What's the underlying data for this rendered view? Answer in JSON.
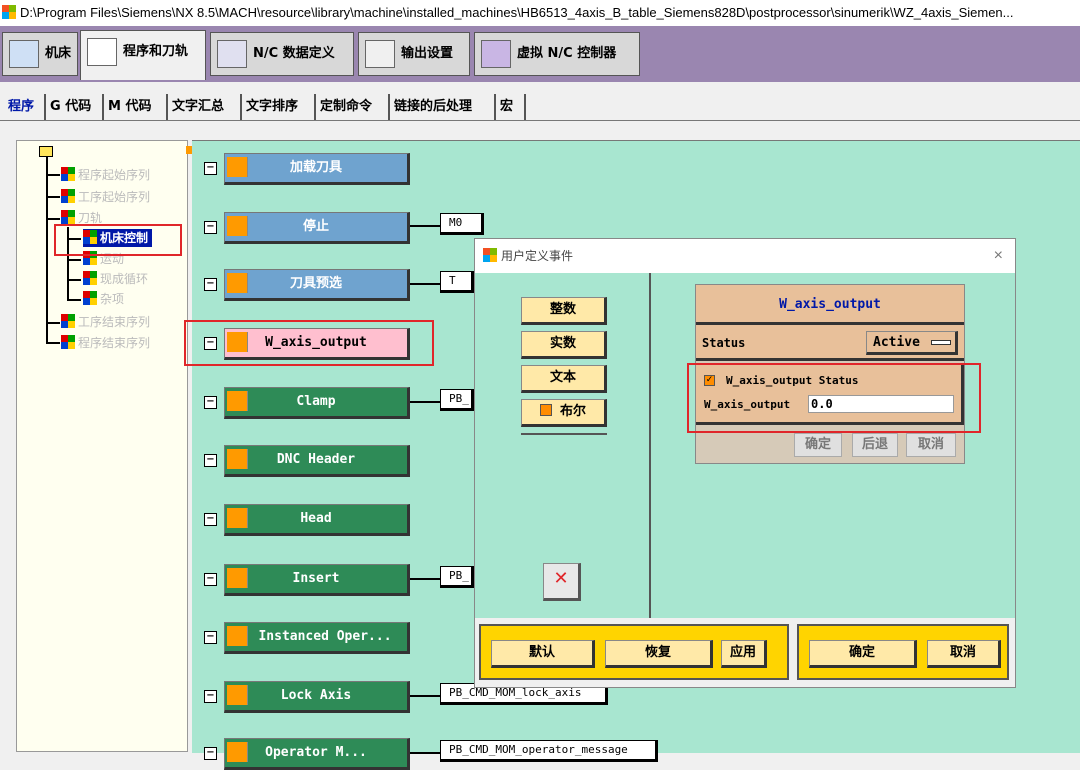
{
  "window": {
    "title": "D:\\Program Files\\Siemens\\NX 8.5\\MACH\\resource\\library\\machine\\installed_machines\\HB6513_4axis_B_table_Siemens828D\\postprocessor\\sinumerik\\WZ_4axis_Siemen..."
  },
  "main_tabs": [
    {
      "label": "机床"
    },
    {
      "label": "程序和刀轨"
    },
    {
      "label": "N/C 数据定义"
    },
    {
      "label": "输出设置"
    },
    {
      "label": "虚拟 N/C 控制器"
    }
  ],
  "sub_tabs": [
    {
      "label": "程序"
    },
    {
      "label": "G 代码"
    },
    {
      "label": "M 代码"
    },
    {
      "label": "文字汇总"
    },
    {
      "label": "文字排序"
    },
    {
      "label": "定制命令"
    },
    {
      "label": "链接的后处理"
    },
    {
      "label": "宏"
    }
  ],
  "tree": {
    "nodes": [
      {
        "label": "程序起始序列"
      },
      {
        "label": "工序起始序列"
      },
      {
        "label": "刀轨"
      },
      {
        "label": "机床控制"
      },
      {
        "label": "运动"
      },
      {
        "label": "现成循环"
      },
      {
        "label": "杂项"
      },
      {
        "label": "工序结束序列"
      },
      {
        "label": "程序结束序列"
      }
    ]
  },
  "events": [
    {
      "label": "加载刀具",
      "cmd": ""
    },
    {
      "label": "停止",
      "cmd": "M0"
    },
    {
      "label": "刀具预选",
      "cmd": "T"
    },
    {
      "label": "W_axis_output",
      "cmd": ""
    },
    {
      "label": "Clamp",
      "cmd": "PB_"
    },
    {
      "label": "DNC Header",
      "cmd": ""
    },
    {
      "label": "Head",
      "cmd": ""
    },
    {
      "label": "Insert",
      "cmd": "PB_"
    },
    {
      "label": "Instanced Oper...",
      "cmd": ""
    },
    {
      "label": "Lock Axis",
      "cmd": "PB_CMD_MOM_lock_axis"
    },
    {
      "label": "Operator M...",
      "cmd": "PB_CMD_MOM_operator_message"
    }
  ],
  "dialog": {
    "title": "用户定义事件",
    "close_glyph": "×",
    "types": [
      {
        "label": "整数"
      },
      {
        "label": "实数"
      },
      {
        "label": "文本"
      },
      {
        "label": "布尔"
      }
    ],
    "card": {
      "title": "W_axis_output",
      "status_label": "Status",
      "status_value": "Active",
      "checkbox_label": "W_axis_output  Status",
      "checkbox_checked": true,
      "field_label": "W_axis_output",
      "field_value": "0.0",
      "ok": "确定",
      "back": "后退",
      "cancel": "取消"
    },
    "bottom": {
      "default": "默认",
      "restore": "恢复",
      "apply": "应用",
      "ok": "确定",
      "cancel": "取消"
    }
  },
  "colors": {
    "accent_red": "#e0262a",
    "tab_bar": "#9a86b0",
    "canvas": "#a8e6d0",
    "event_selected": "#ffbfcf"
  }
}
